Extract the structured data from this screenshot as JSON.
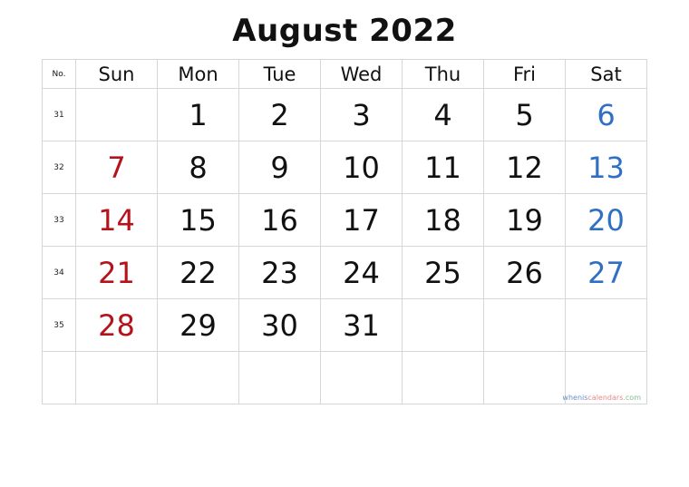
{
  "title": "August 2022",
  "header": {
    "no": "No.",
    "days": [
      "Sun",
      "Mon",
      "Tue",
      "Wed",
      "Thu",
      "Fri",
      "Sat"
    ]
  },
  "weeks": [
    {
      "no": "31",
      "days": [
        "",
        "1",
        "2",
        "3",
        "4",
        "5",
        "6"
      ]
    },
    {
      "no": "32",
      "days": [
        "7",
        "8",
        "9",
        "10",
        "11",
        "12",
        "13"
      ]
    },
    {
      "no": "33",
      "days": [
        "14",
        "15",
        "16",
        "17",
        "18",
        "19",
        "20"
      ]
    },
    {
      "no": "34",
      "days": [
        "21",
        "22",
        "23",
        "24",
        "25",
        "26",
        "27"
      ]
    },
    {
      "no": "35",
      "days": [
        "28",
        "29",
        "30",
        "31",
        "",
        "",
        ""
      ]
    },
    {
      "no": "",
      "days": [
        "",
        "",
        "",
        "",
        "",
        "",
        ""
      ]
    }
  ],
  "watermark": {
    "part1": "whenis",
    "part2": "calendars",
    "part3": ".com"
  },
  "colors": {
    "sunday": "#b5121b",
    "saturday": "#2f6fc4",
    "grid": "#d6d6d6"
  }
}
